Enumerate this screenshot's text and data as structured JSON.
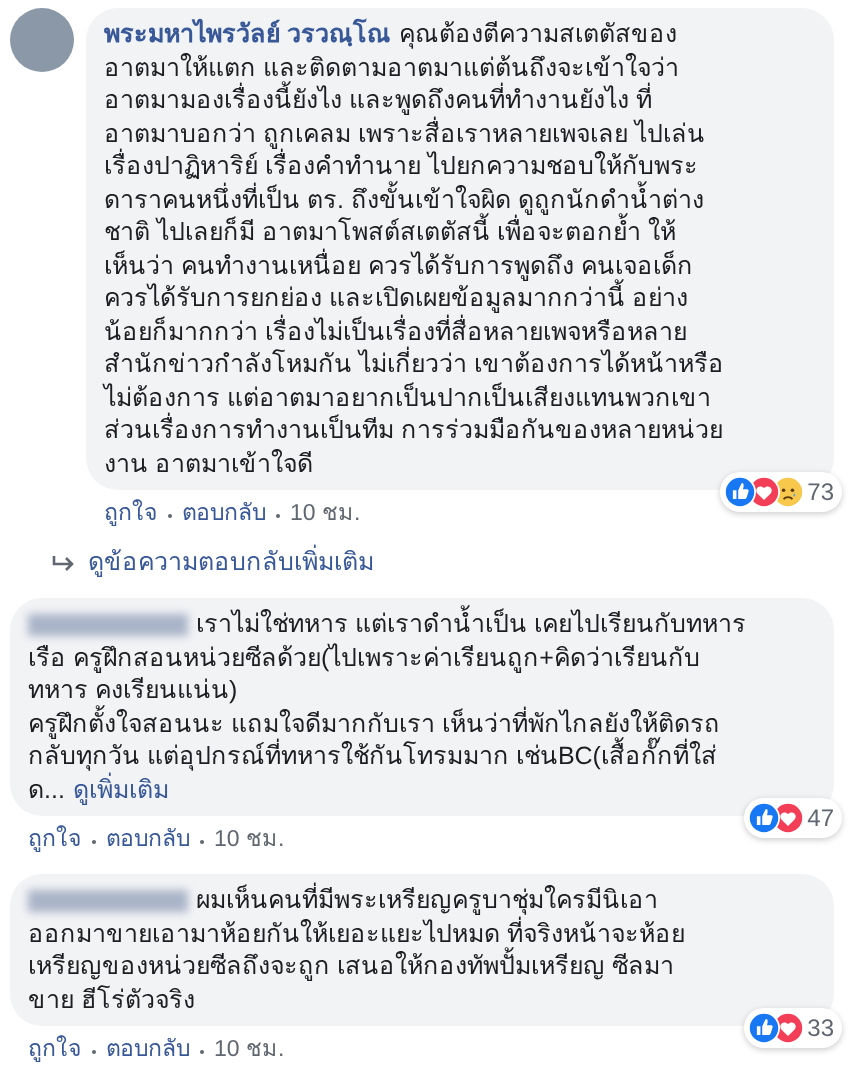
{
  "comments": [
    {
      "avatar": true,
      "author": {
        "kind": "named",
        "name": "พระมหาไพรวัลย์ วรวณฺโณ"
      },
      "text": "คุณต้องตีความสเตตัสของ\nอาตมาให้แตก และติดตามอาตมาแต่ต้นถึงจะเข้าใจว่า\nอาตมามองเรื่องนี้ยังไง และพูดถึงคนที่ทำงานยังไง ที่\nอาตมาบอกว่า ถูกเคลม เพราะสื่อเราหลายเพจเลย ไปเล่น\nเรื่องปาฏิหาริย์ เรื่องคำทำนาย ไปยกความชอบให้กับพระ\nดาราคนหนึ่งที่เป็น ตร. ถึงขั้นเข้าใจผิด ดูถูกนักดำน้ำต่าง\nชาติ ไปเลยก็มี อาตมาโพสต์สเตตัสนี้ เพื่อจะตอกย้ำ ให้\nเห็นว่า คนทำงานเหนื่อย ควรได้รับการพูดถึง คนเจอเด็ก\nควรได้รับการยกย่อง และเปิดเผยข้อมูลมากกว่านี้ อย่าง\nน้อยก็มากกว่า เรื่องไม่เป็นเรื่องที่สื่อหลายเพจหรือหลาย\nสำนักข่าวกำลังโหมกัน ไม่เกี่ยวว่า เขาต้องการได้หน้าหรือ\nไม่ต้องการ แต่อาตมาอยากเป็นปากเป็นเสียงแทนพวกเขา\nส่วนเรื่องการทำงานเป็นทีม การร่วมมือกันของหลายหน่วย\nงาน อาตมาเข้าใจดี",
      "reactions": [
        {
          "kind": "like"
        },
        {
          "kind": "love"
        },
        {
          "kind": "sad"
        }
      ],
      "reaction_count": "73",
      "actions": [
        "ถูกใจ",
        "ตอบกลับ",
        "10 ชม."
      ],
      "more_replies": "ดูข้อความตอบกลับเพิ่มเติม"
    },
    {
      "avatar": false,
      "author": {
        "kind": "blurred"
      },
      "text": "เราไม่ใช่ทหาร แต่เราดำน้ำเป็น เคยไปเรียนกับทหาร\nเรือ ครูฝึกสอนหน่วยซีลด้วย(ไปเพราะค่าเรียนถูก+คิดว่าเรียนกับ\nทหาร คงเรียนแน่น)\nครูฝึกตั้งใจสอนนะ แถมใจดีมากกับเรา เห็นว่าที่พักไกลยังให้ติดรถ\nกลับทุกวัน แต่อุปกรณ์ที่ทหารใช้กันโทรมมาก เช่นBC(เสื้อกั๊กที่ใส่\nด...",
      "see_more": "ดูเพิ่มเติม",
      "reactions": [
        {
          "kind": "like"
        },
        {
          "kind": "love"
        }
      ],
      "reaction_count": "47",
      "actions": [
        "ถูกใจ",
        "ตอบกลับ",
        "10 ชม."
      ]
    },
    {
      "avatar": false,
      "author": {
        "kind": "blurred"
      },
      "text": "ผมเห็นคนที่มีพระเหรียญครูบาชุ่มใครมีนิเอา\nออกมาขายเอามาห้อยกันให้เยอะแยะไปหมด ที่จริงหน้าจะห้อย\nเหรียญของหน่วยซีลถึงจะถูก เสนอให้กองทัพปั้มเหรียญ ซีลมา\nขาย ฮีโร่ตัวจริง",
      "reactions": [
        {
          "kind": "like"
        },
        {
          "kind": "love"
        }
      ],
      "reaction_count": "33",
      "actions": [
        "ถูกใจ",
        "ตอบกลับ",
        "10 ชม."
      ]
    }
  ]
}
